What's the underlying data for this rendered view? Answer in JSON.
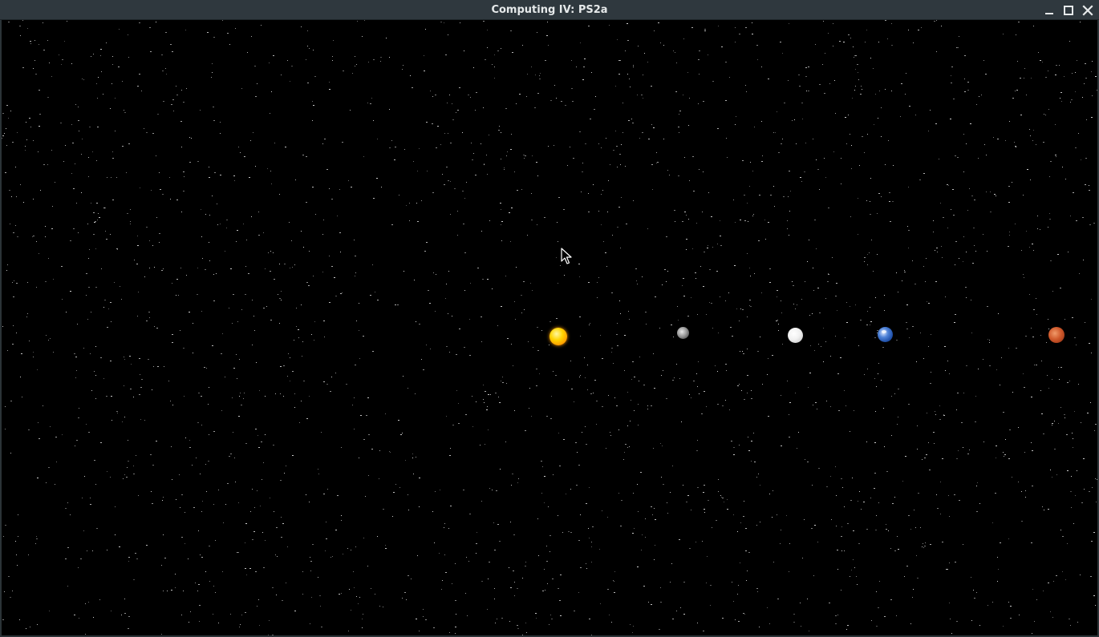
{
  "window": {
    "title": "Computing IV: PS2a"
  },
  "controls": {
    "minimize_icon": "minimize-icon",
    "maximize_icon": "maximize-icon",
    "close_icon": "close-icon"
  },
  "bodies": [
    {
      "name": "sun",
      "color": "#ffcc00"
    },
    {
      "name": "mercury",
      "color": "#9a9a9a"
    },
    {
      "name": "venus",
      "color": "#f1f1f1"
    },
    {
      "name": "earth",
      "color": "#3a6cc8"
    },
    {
      "name": "mars",
      "color": "#c0502a"
    }
  ],
  "colors": {
    "titlebar": "#2f383e",
    "title_text": "#e6e9ea",
    "space": "#000000",
    "stars": "#dcdcdc"
  }
}
